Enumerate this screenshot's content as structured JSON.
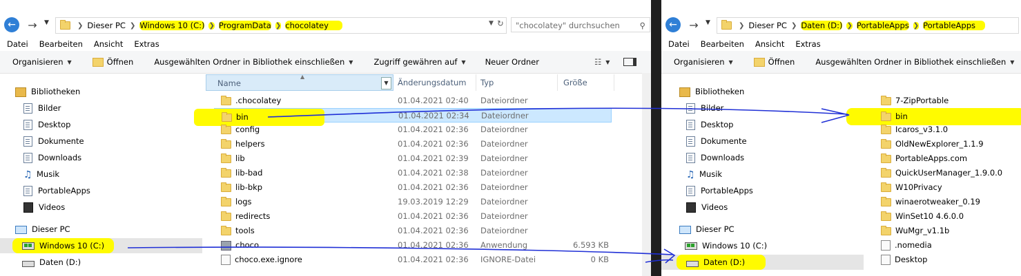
{
  "left": {
    "address": {
      "crumbs": [
        "Dieser PC",
        "Windows 10 (C:)",
        "ProgramData",
        "chocolatey"
      ]
    },
    "search_placeholder": "\"chocolatey\" durchsuchen",
    "menu": [
      "Datei",
      "Bearbeiten",
      "Ansicht",
      "Extras"
    ],
    "toolbar": {
      "organize": "Organisieren",
      "open": "Öffnen",
      "include": "Ausgewählten Ordner in Bibliothek einschließen",
      "share": "Zugriff gewähren auf",
      "new_folder": "Neuer Ordner",
      "help": "?"
    },
    "nav": {
      "libraries": "Bibliotheken",
      "items": [
        "Bilder",
        "Desktop",
        "Dokumente",
        "Downloads",
        "Musik",
        "PortableApps",
        "Videos"
      ],
      "this_pc": "Dieser PC",
      "drives": [
        "Windows 10 (C:)",
        "Daten (D:)"
      ]
    },
    "columns": [
      "Name",
      "Änderungsdatum",
      "Typ",
      "Größe"
    ],
    "files": [
      {
        "name": ".chocolatey",
        "date": "01.04.2021 02:40",
        "type": "Dateiordner",
        "size": ""
      },
      {
        "name": "bin",
        "date": "01.04.2021 02:34",
        "type": "Dateiordner",
        "size": ""
      },
      {
        "name": "config",
        "date": "01.04.2021 02:36",
        "type": "Dateiordner",
        "size": ""
      },
      {
        "name": "helpers",
        "date": "01.04.2021 02:36",
        "type": "Dateiordner",
        "size": ""
      },
      {
        "name": "lib",
        "date": "01.04.2021 02:39",
        "type": "Dateiordner",
        "size": ""
      },
      {
        "name": "lib-bad",
        "date": "01.04.2021 02:38",
        "type": "Dateiordner",
        "size": ""
      },
      {
        "name": "lib-bkp",
        "date": "01.04.2021 02:36",
        "type": "Dateiordner",
        "size": ""
      },
      {
        "name": "logs",
        "date": "19.03.2019 12:29",
        "type": "Dateiordner",
        "size": ""
      },
      {
        "name": "redirects",
        "date": "01.04.2021 02:36",
        "type": "Dateiordner",
        "size": ""
      },
      {
        "name": "tools",
        "date": "01.04.2021 02:36",
        "type": "Dateiordner",
        "size": ""
      },
      {
        "name": "choco",
        "date": "01.04.2021 02:36",
        "type": "Anwendung",
        "size": "6.593 KB"
      },
      {
        "name": "choco.exe.ignore",
        "date": "01.04.2021 02:36",
        "type": "IGNORE-Datei",
        "size": "0 KB"
      }
    ]
  },
  "right": {
    "address": {
      "crumbs": [
        "Dieser PC",
        "Daten (D:)",
        "PortableApps",
        "PortableApps"
      ]
    },
    "menu": [
      "Datei",
      "Bearbeiten",
      "Ansicht",
      "Extras"
    ],
    "toolbar": {
      "organize": "Organisieren",
      "open": "Öffnen",
      "include": "Ausgewählten Ordner in Bibliothek einschließen"
    },
    "nav": {
      "libraries": "Bibliotheken",
      "items": [
        "Bilder",
        "Desktop",
        "Dokumente",
        "Downloads",
        "Musik",
        "PortableApps",
        "Videos"
      ],
      "this_pc": "Dieser PC",
      "drives": [
        "Windows 10 (C:)",
        "Daten (D:)"
      ]
    },
    "files": [
      "7-ZipPortable",
      "bin",
      "Icaros_v3.1.0",
      "OldNewExplorer_1.1.9",
      "PortableApps.com",
      "QuickUserManager_1.9.0.0",
      "W10Privacy",
      "winaerotweaker_0.19",
      "WinSet10 4.6.0.0",
      "WuMgr_v1.1b",
      ".nomedia",
      "Desktop"
    ]
  },
  "colors": {
    "highlight": "#fffb00",
    "annotation": "#1f2fd6",
    "selection": "#cce8ff"
  }
}
